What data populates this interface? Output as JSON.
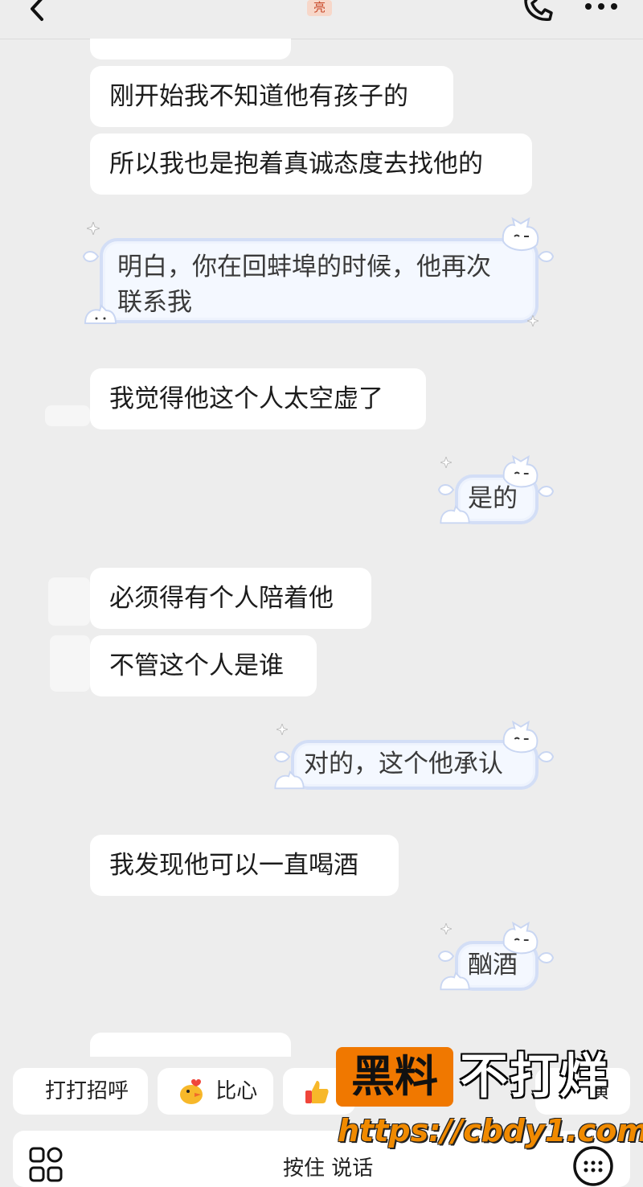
{
  "header": {
    "contact_name": "亮"
  },
  "messages": [
    {
      "side": "left",
      "text": "刚开始我不知道他有孩子的"
    },
    {
      "side": "left",
      "text": "所以我也是抱着真诚态度去找他的"
    },
    {
      "side": "right",
      "line1": "明白，你在回蚌埠的时候，他再次",
      "line2": "联系我"
    },
    {
      "side": "left",
      "text": "我觉得他这个人太空虚了"
    },
    {
      "side": "right",
      "text": "是的"
    },
    {
      "side": "left",
      "text": "必须得有个人陪着他"
    },
    {
      "side": "left",
      "text": "不管这个人是谁"
    },
    {
      "side": "right",
      "text": "对的，这个他承认"
    },
    {
      "side": "left",
      "text": "我发现他可以一直喝酒"
    },
    {
      "side": "right",
      "text": "酗酒"
    }
  ],
  "quick_replies": {
    "greet_label": "打打招呼",
    "heart_label": "比心",
    "like_partial": "🤙",
    "last_partial": "演"
  },
  "input_bar": {
    "hold_to_talk": "按住 说话"
  },
  "watermark": {
    "box_text": "黑料",
    "side_text": "不打烊",
    "url": "https://cbdy1.com"
  },
  "colors": {
    "background": "#ededed",
    "bubble": "#ffffff",
    "cute_bubble_border": "#d3def6",
    "watermark_orange": "#f07800"
  }
}
